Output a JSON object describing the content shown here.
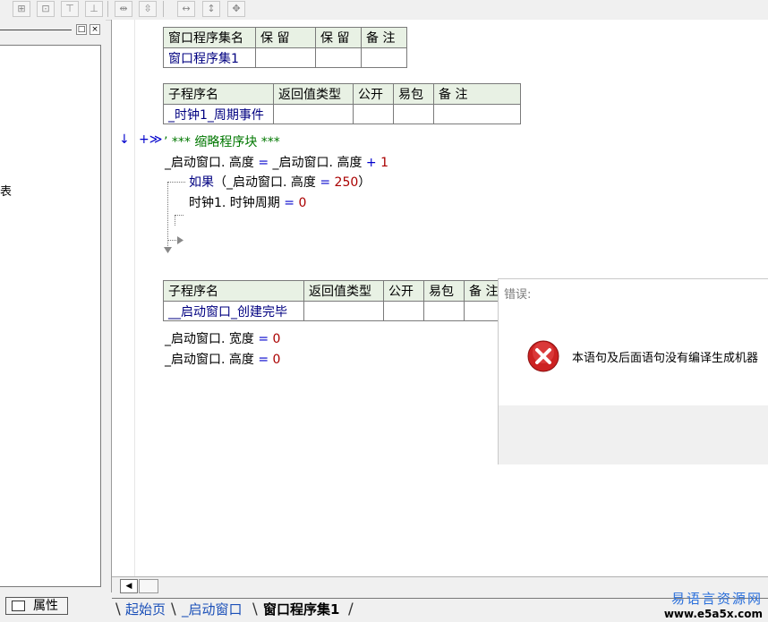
{
  "toolbar": {
    "buttons": [
      "align-left-icon",
      "align-center-icon",
      "align-top-icon",
      "align-bottom-icon",
      "space-horizontal-icon",
      "space-vertical-icon",
      "same-width-icon",
      "same-height-icon",
      "same-size-icon"
    ]
  },
  "left_panel": {
    "min_label": "□",
    "close_label": "×",
    "partial_char": "表",
    "properties_tab": "属性"
  },
  "program_set_table": {
    "headers": [
      "窗口程序集名",
      "保 留",
      "保 留",
      "备 注"
    ],
    "row": [
      "窗口程序集1",
      "",
      "",
      ""
    ]
  },
  "sub1_table": {
    "headers": [
      "子程序名",
      "返回值类型",
      "公开",
      "易包",
      "备 注"
    ],
    "row": [
      "_时钟1_周期事件",
      "",
      "",
      "",
      ""
    ]
  },
  "sub2_table": {
    "headers": [
      "子程序名",
      "返回值类型",
      "公开",
      "易包",
      "备 注"
    ],
    "row": [
      "__启动窗口_创建完毕",
      "",
      "",
      "",
      ""
    ]
  },
  "code": {
    "marker": "↓",
    "collapse": "+≫",
    "comment": "’ *** 缩略程序块 ***",
    "line1_lhs": "_启动窗口. 高度",
    "line1_eq": " = ",
    "line1_rhs": "_启动窗口. 高度",
    "line1_op": " + ",
    "line1_num": "1",
    "if_kw": "如果",
    "if_cond_open": "（_启动窗口. 高度",
    "if_eq": " = ",
    "if_num": "250",
    "if_close": "）",
    "line3_lhs": "时钟1. 时钟周期",
    "line3_eq": " = ",
    "line3_num": "0",
    "line4_lhs": "_启动窗口. 宽度",
    "line4_eq": " = ",
    "line4_num": "0",
    "line5_lhs": "_启动窗口. 高度",
    "line5_eq": " = ",
    "line5_num": "0"
  },
  "dialog": {
    "title": "错误:",
    "message": "本语句及后面语句没有编译生成机器"
  },
  "scrollbar": {
    "left_arrow": "◀"
  },
  "tabs": {
    "items": [
      "起始页",
      "_启动窗口",
      "窗口程序集1"
    ],
    "active_index": 2
  },
  "watermark": {
    "cn": "易语言资源网",
    "url": "www.e5a5x.com"
  },
  "colors": {
    "header_bg": "#e8f1e4",
    "keyword": "#000080",
    "number": "#aa0000",
    "comment": "#007700",
    "tab_blue": "#1a4fb8",
    "error_red": "#cc2222"
  }
}
